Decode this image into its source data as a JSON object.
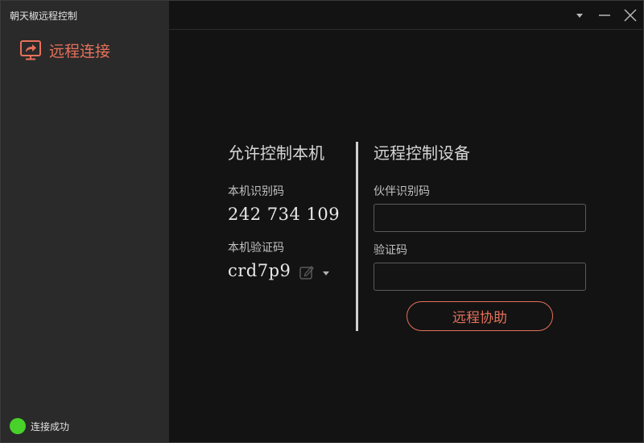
{
  "app": {
    "title": "朝天椒远程控制"
  },
  "sidebar": {
    "nav": [
      {
        "label": "远程连接",
        "icon": "remote-screen-icon",
        "active": true
      }
    ]
  },
  "status": {
    "text": "连接成功",
    "color": "#47d12a"
  },
  "titlebar": {
    "buttons": [
      "dropdown-icon",
      "minimize-icon",
      "close-icon"
    ]
  },
  "allow_control": {
    "heading": "允许控制本机",
    "id_label": "本机识别码",
    "id_value": "242 734 109",
    "code_label": "本机验证码",
    "code_value": "crd7p9"
  },
  "remote_control": {
    "heading": "远程控制设备",
    "partner_label": "伙伴识别码",
    "partner_value": "",
    "code_label": "验证码",
    "code_value": "",
    "button_label": "远程协助"
  },
  "colors": {
    "accent": "#e5715b",
    "sidebar_bg": "#2a2a2a",
    "main_bg": "#131313"
  }
}
